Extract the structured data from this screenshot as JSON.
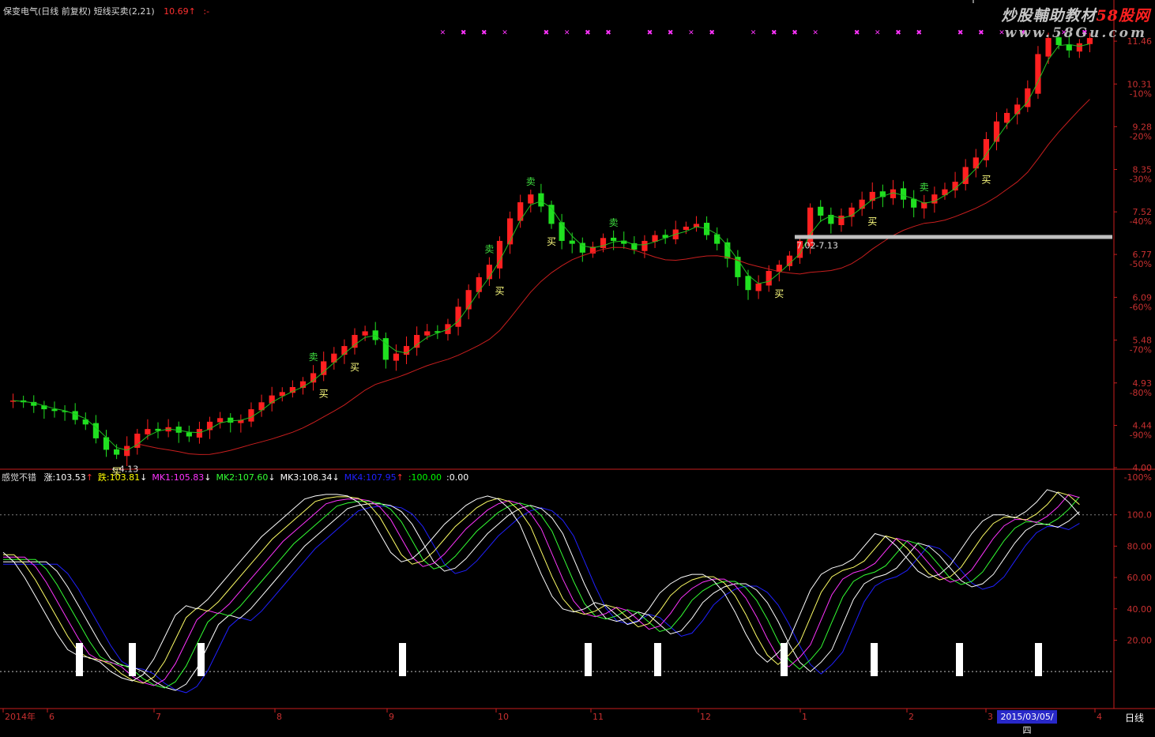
{
  "header": {
    "name": "保变电气(日线 前复权) 短线买卖(2,21)",
    "price": "10.69",
    "price_arrow": "↑",
    "tail": ":-"
  },
  "watermark": {
    "line1_a": "炒股輔助教材",
    "line1_b": "58股网",
    "line2": "www.58Gu.com"
  },
  "indicator_header": {
    "name": "感觉不错",
    "items": [
      {
        "label": "涨:",
        "value": "103.53",
        "arrow": "↑",
        "color": "#ffffff",
        "arrow_color": "#ff3030"
      },
      {
        "label": "跌:",
        "value": "103.81",
        "arrow": "↓",
        "color": "#ffff00",
        "arrow_color": "#ffffff"
      },
      {
        "label": "MK1:",
        "value": "105.83",
        "arrow": "↓",
        "color": "#ff33ff",
        "arrow_color": "#ffffff"
      },
      {
        "label": "MK2:",
        "value": "107.60",
        "arrow": "↓",
        "color": "#33ff33",
        "arrow_color": "#ffffff"
      },
      {
        "label": "MK3:",
        "value": "108.34",
        "arrow": "↓",
        "color": "#ffffff",
        "arrow_color": "#ffffff"
      },
      {
        "label": "MK4:",
        "value": "107.95",
        "arrow": "↑",
        "color": "#2020ff",
        "arrow_color": "#ff3030"
      },
      {
        "label": ":",
        "value": "100.00",
        "arrow": "",
        "color": "#00ff00",
        "arrow_color": ""
      },
      {
        "label": ":",
        "value": "0.00",
        "arrow": "",
        "color": "#ffffff",
        "arrow_color": ""
      }
    ]
  },
  "timeframe_label": "日线",
  "cursor_date": "2015/03/05/四",
  "colors": {
    "up": "#ff2020",
    "down": "#20e020",
    "ma_short": "#20c020",
    "ma_long": "#c81e1e",
    "axis": "#c81e1e",
    "signal_magenta": "#ff33ff"
  },
  "chart_data": [
    {
      "type": "candlestick",
      "title": "保变电气(日线 前复权) 短线买卖(2,21)",
      "price_axis_ticks": [
        "11.46",
        "10.31",
        "9.28",
        "8.35",
        "7.52",
        "6.77",
        "6.09",
        "5.48",
        "4.93",
        "4.44",
        "4.00"
      ],
      "pct_axis_ticks": [
        "-10%",
        "-20%",
        "-30%",
        "-40%",
        "-50%",
        "-60%",
        "-70%",
        "-80%",
        "-90%",
        "-100%"
      ],
      "ylim": [
        4.0,
        12.2
      ],
      "scale": "log",
      "x_ticks": [
        "2014年",
        "6",
        "7",
        "8",
        "9",
        "10",
        "11",
        "12",
        "1",
        "2",
        "3",
        "4"
      ],
      "annotations": {
        "buy_label": "买",
        "sell_label": "卖",
        "low_marker": "←4.13",
        "range_label": "7.02-7.13"
      },
      "series_close_path": [
        4.72,
        4.7,
        4.66,
        4.62,
        4.6,
        4.59,
        4.5,
        4.45,
        4.3,
        4.18,
        4.13,
        4.22,
        4.35,
        4.4,
        4.38,
        4.42,
        4.36,
        4.32,
        4.4,
        4.48,
        4.52,
        4.47,
        4.5,
        4.62,
        4.7,
        4.78,
        4.82,
        4.88,
        4.95,
        5.05,
        5.2,
        5.3,
        5.4,
        5.55,
        5.6,
        5.48,
        5.22,
        5.3,
        5.4,
        5.55,
        5.6,
        5.58,
        5.7,
        5.95,
        6.2,
        6.4,
        6.6,
        7.0,
        7.4,
        7.7,
        7.85,
        7.62,
        7.3,
        7.0,
        6.95,
        6.8,
        6.9,
        7.05,
        7.0,
        6.95,
        6.85,
        7.0,
        7.1,
        7.05,
        7.2,
        7.25,
        7.3,
        7.1,
        6.95,
        6.7,
        6.4,
        6.2,
        6.3,
        6.5,
        6.6,
        6.75,
        7.0,
        7.6,
        7.45,
        7.3,
        7.45,
        7.6,
        7.75,
        7.9,
        7.8,
        7.95,
        7.75,
        7.6,
        7.7,
        7.85,
        7.95,
        8.1,
        8.4,
        8.6,
        9.0,
        9.4,
        9.6,
        9.8,
        10.2,
        11.1,
        11.55,
        11.35,
        11.2,
        11.4,
        11.55
      ]
    },
    {
      "type": "line",
      "title": "感觉不错",
      "y_ticks": [
        "100.0",
        "80.00",
        "60.00",
        "40.00",
        "20.00"
      ],
      "ylim": [
        -10,
        120
      ],
      "series": [
        {
          "name": "涨",
          "color": "#ffffff",
          "offset": 0
        },
        {
          "name": "跌",
          "color": "#ffff66",
          "offset": 1
        },
        {
          "name": "MK1",
          "color": "#ff33ff",
          "offset": 2
        },
        {
          "name": "MK2",
          "color": "#33ff33",
          "offset": 3
        },
        {
          "name": "MK3",
          "color": "#ffffff",
          "offset": 4
        },
        {
          "name": "MK4",
          "color": "#2020ff",
          "offset": 5
        }
      ],
      "base_values": [
        76,
        70,
        60,
        48,
        36,
        24,
        14,
        10,
        9,
        6,
        0,
        -4,
        -6,
        -2,
        8,
        22,
        36,
        42,
        40,
        46,
        54,
        62,
        70,
        78,
        86,
        92,
        98,
        104,
        110,
        112,
        113,
        113,
        112,
        108,
        100,
        88,
        76,
        70,
        72,
        78,
        86,
        94,
        100,
        106,
        110,
        112,
        110,
        104,
        94,
        78,
        62,
        48,
        40,
        38,
        40,
        44,
        42,
        36,
        30,
        32,
        40,
        50,
        56,
        60,
        62,
        62,
        58,
        50,
        38,
        24,
        12,
        6,
        12,
        20,
        36,
        52,
        62,
        66,
        68,
        72,
        80,
        88,
        86,
        80,
        72,
        64,
        60,
        62,
        68,
        78,
        88,
        96,
        100,
        100,
        98,
        102,
        108,
        116,
        114,
        108,
        100
      ]
    }
  ]
}
